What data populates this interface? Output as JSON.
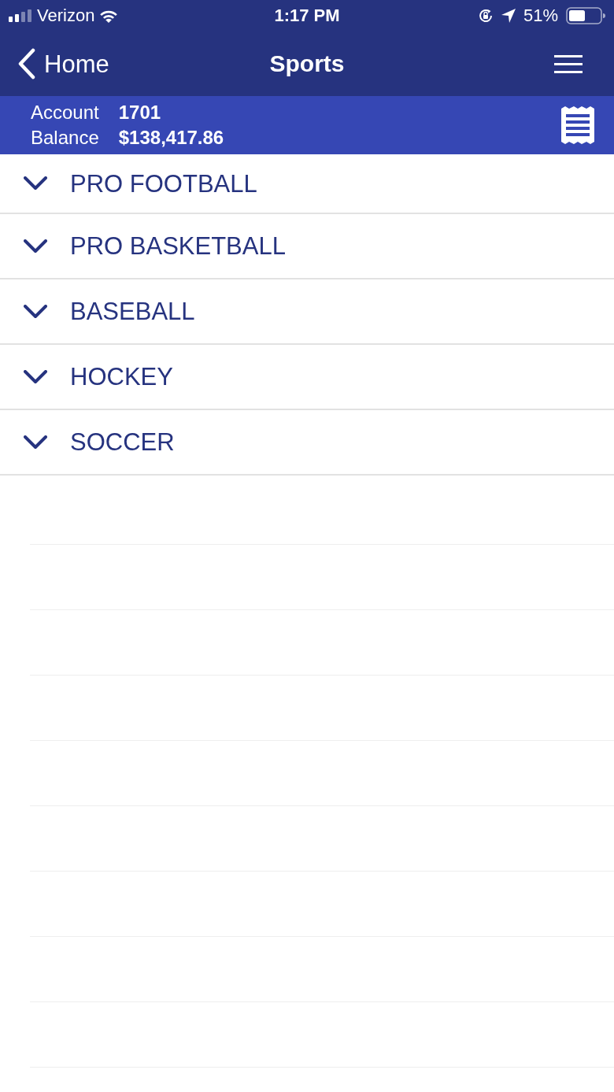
{
  "status_bar": {
    "carrier": "Verizon",
    "time": "1:17 PM",
    "battery_percent": "51%"
  },
  "nav_bar": {
    "back_label": "Home",
    "title": "Sports"
  },
  "account_bar": {
    "account_label": "Account",
    "account_value": "1701",
    "balance_label": "Balance",
    "balance_value": "$138,417.86"
  },
  "sports": [
    {
      "label": "PRO FOOTBALL",
      "expanded": false
    },
    {
      "label": "PRO BASKETBALL",
      "expanded": false
    },
    {
      "label": "BASEBALL",
      "expanded": false
    },
    {
      "label": "HOCKEY",
      "expanded": false
    },
    {
      "label": "SOCCER",
      "expanded": false
    }
  ]
}
